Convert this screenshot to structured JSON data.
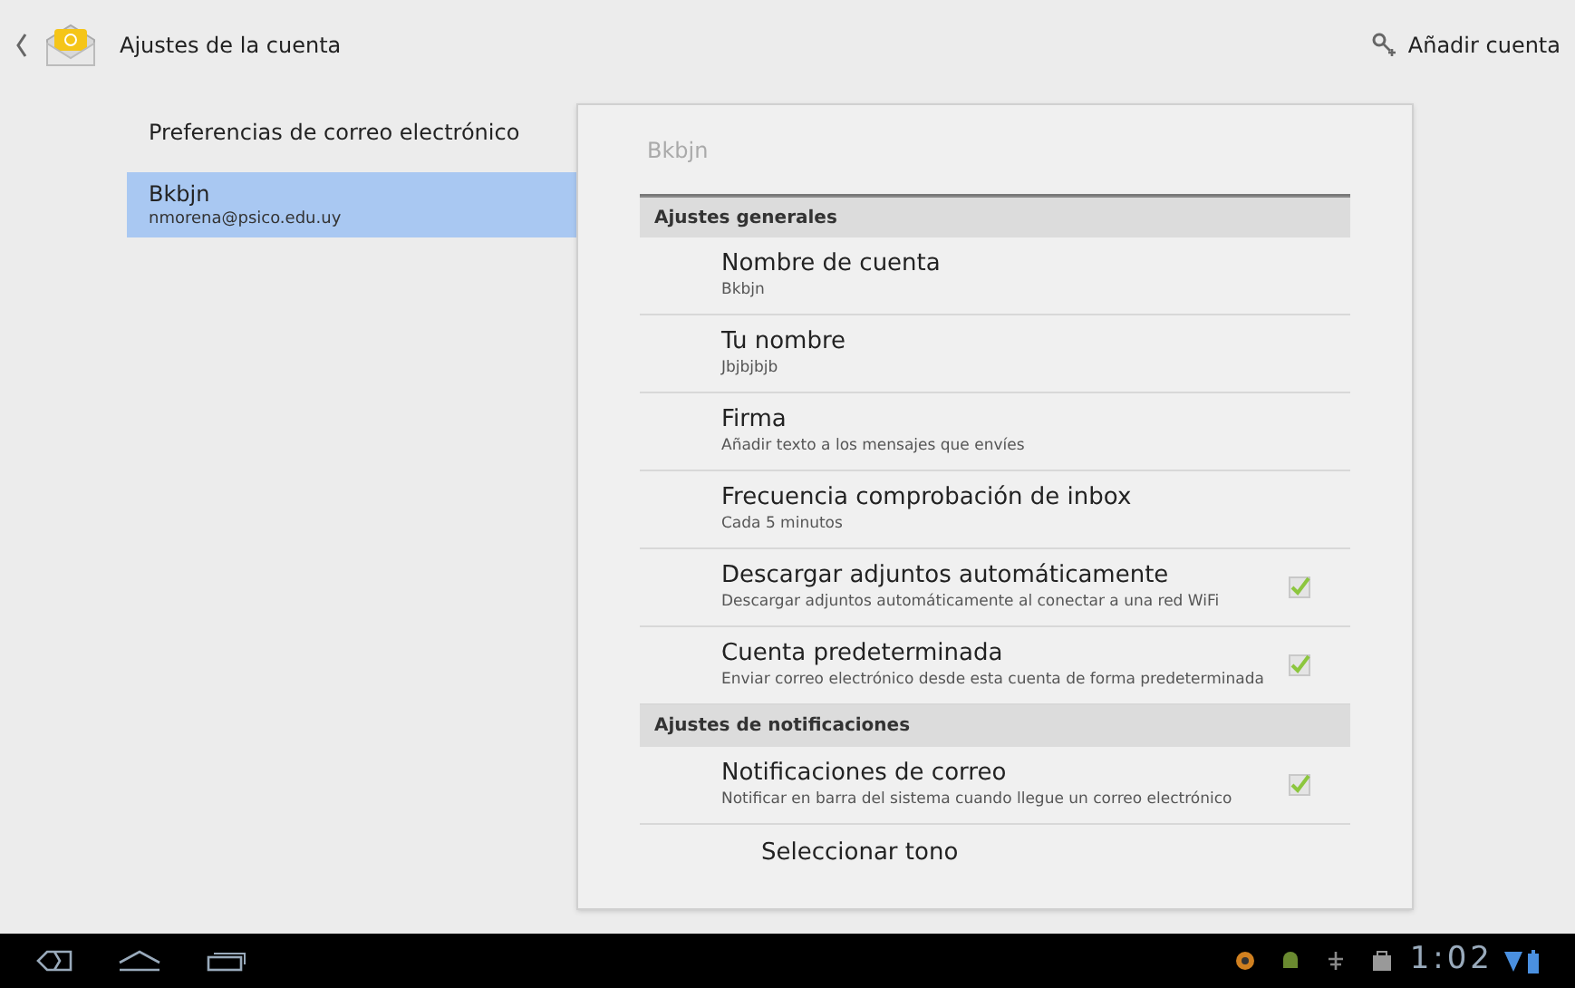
{
  "action_bar": {
    "title": "Ajustes de la cuenta",
    "action": "Añadir cuenta"
  },
  "sidebar": {
    "items": [
      {
        "title": "Preferencias de correo electrónico",
        "selected": false
      },
      {
        "title": "Bkbjn",
        "subtitle": "nmorena@psico.edu.uy",
        "selected": true
      }
    ]
  },
  "panel": {
    "title": "Bkbjn",
    "rows": [
      {
        "kind": "header",
        "title": "Ajustes generales"
      },
      {
        "kind": "item",
        "title": "Nombre de cuenta",
        "summary": "Bkbjn"
      },
      {
        "kind": "item",
        "title": "Tu nombre",
        "summary": "Jbjbjbjb"
      },
      {
        "kind": "item",
        "title": "Firma",
        "summary": "Añadir texto a los mensajes que envíes"
      },
      {
        "kind": "item",
        "title": "Frecuencia comprobación de inbox",
        "summary": "Cada 5 minutos"
      },
      {
        "kind": "checkbox",
        "title": "Descargar adjuntos automáticamente",
        "summary": "Descargar adjuntos automáticamente al conectar a una red WiFi",
        "checked": true
      },
      {
        "kind": "checkbox",
        "title": "Cuenta predeterminada",
        "summary": "Enviar correo electrónico desde esta cuenta de forma predeterminada",
        "checked": true
      },
      {
        "kind": "header",
        "title": "Ajustes de notificaciones"
      },
      {
        "kind": "checkbox",
        "title": "Notificaciones de correo",
        "summary": "Notificar en barra del sistema cuando llegue un correo electrónico",
        "checked": true
      },
      {
        "kind": "sub",
        "title": "Seleccionar tono"
      }
    ]
  },
  "status_bar": {
    "time": "1:02"
  }
}
